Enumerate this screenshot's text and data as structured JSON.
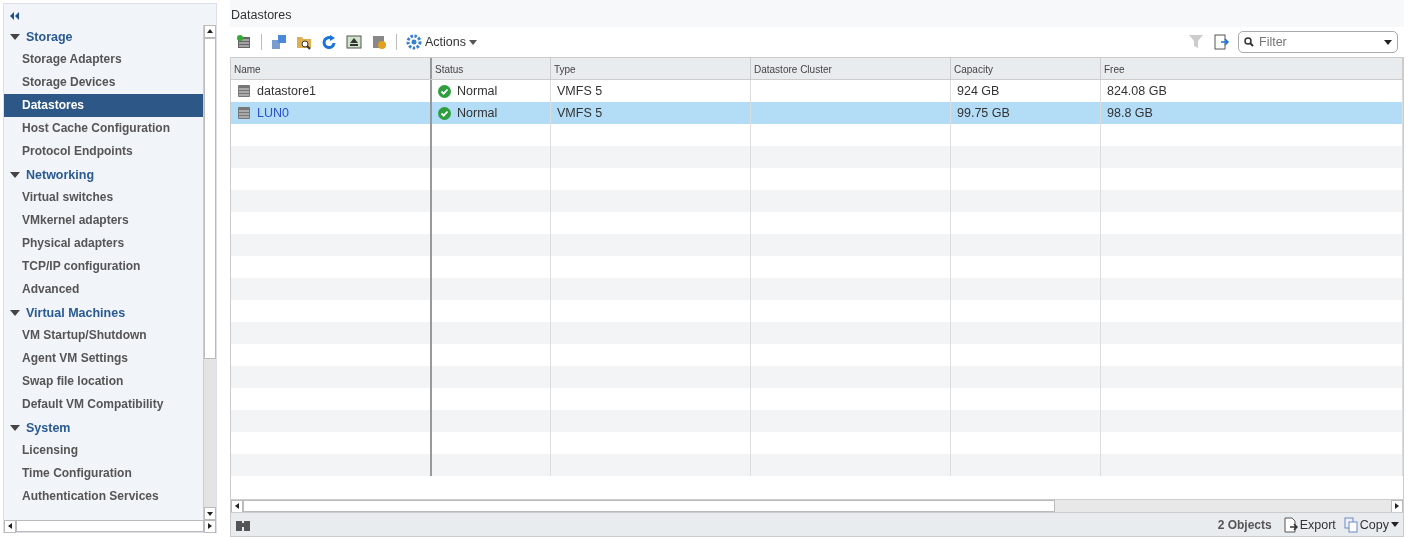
{
  "sidebar": {
    "groups": [
      {
        "label": "Storage",
        "expanded": true,
        "items": [
          {
            "label": "Storage Adapters",
            "selected": false
          },
          {
            "label": "Storage Devices",
            "selected": false
          },
          {
            "label": "Datastores",
            "selected": true
          },
          {
            "label": "Host Cache Configuration",
            "selected": false
          },
          {
            "label": "Protocol Endpoints",
            "selected": false
          }
        ]
      },
      {
        "label": "Networking",
        "expanded": true,
        "items": [
          {
            "label": "Virtual switches",
            "selected": false
          },
          {
            "label": "VMkernel adapters",
            "selected": false
          },
          {
            "label": "Physical adapters",
            "selected": false
          },
          {
            "label": "TCP/IP configuration",
            "selected": false
          },
          {
            "label": "Advanced",
            "selected": false
          }
        ]
      },
      {
        "label": "Virtual Machines",
        "expanded": true,
        "items": [
          {
            "label": "VM Startup/Shutdown",
            "selected": false
          },
          {
            "label": "Agent VM Settings",
            "selected": false
          },
          {
            "label": "Swap file location",
            "selected": false
          },
          {
            "label": "Default VM Compatibility",
            "selected": false
          }
        ]
      },
      {
        "label": "System",
        "expanded": true,
        "items": [
          {
            "label": "Licensing",
            "selected": false
          },
          {
            "label": "Time Configuration",
            "selected": false
          },
          {
            "label": "Authentication Services",
            "selected": false
          }
        ]
      }
    ]
  },
  "panel": {
    "title": "Datastores",
    "actions_label": "Actions",
    "filter": {
      "placeholder": "Filter"
    }
  },
  "table": {
    "columns": [
      "Name",
      "Status",
      "Type",
      "Datastore Cluster",
      "Capacity",
      "Free"
    ],
    "rows": [
      {
        "name": "datastore1",
        "status": "Normal",
        "kind": "ok",
        "type": "VMFS 5",
        "capacity": "924  GB",
        "free": "824.08  GB",
        "selected": false
      },
      {
        "name": "LUN0",
        "status": "Normal",
        "kind": "ok",
        "type": "VMFS 5",
        "capacity": "99.75  GB",
        "free": "98.8  GB",
        "selected": true
      }
    ]
  },
  "footer": {
    "count": "2 Objects",
    "export": "Export",
    "copy": "Copy"
  }
}
